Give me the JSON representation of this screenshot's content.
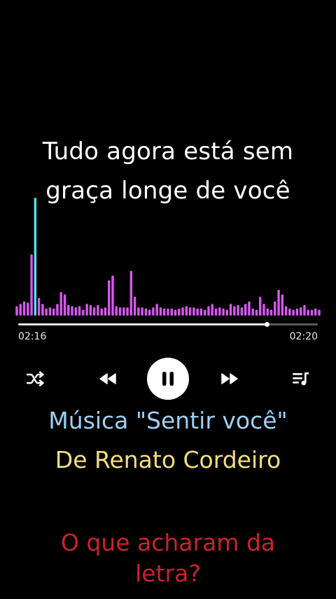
{
  "lyric": {
    "line1": "Tudo agora está sem",
    "line2": "graça longe de você"
  },
  "player": {
    "elapsed": "02:16",
    "total": "02:20",
    "progress_fraction": 0.83,
    "state": "playing",
    "controls": {
      "shuffle_icon": "shuffle-icon",
      "previous_icon": "rewind-icon",
      "pause_icon": "pause-icon",
      "next_icon": "fast-forward-icon",
      "queue_icon": "playlist-icon"
    }
  },
  "visualizer": {
    "colors": {
      "bar": "#d957f2",
      "highlight": "#4fe3ee"
    },
    "levels": [
      0.08,
      0.1,
      0.12,
      0.11,
      0.52,
      1.0,
      0.15,
      0.1,
      0.06,
      0.07,
      0.06,
      0.1,
      0.2,
      0.18,
      0.09,
      0.08,
      0.07,
      0.08,
      0.05,
      0.1,
      0.09,
      0.07,
      0.09,
      0.06,
      0.07,
      0.3,
      0.34,
      0.08,
      0.07,
      0.07,
      0.07,
      0.38,
      0.16,
      0.07,
      0.07,
      0.06,
      0.05,
      0.07,
      0.1,
      0.07,
      0.06,
      0.06,
      0.06,
      0.05,
      0.06,
      0.07,
      0.08,
      0.07,
      0.07,
      0.06,
      0.06,
      0.05,
      0.08,
      0.1,
      0.06,
      0.07,
      0.06,
      0.05,
      0.1,
      0.08,
      0.09,
      0.07,
      0.1,
      0.12,
      0.06,
      0.05,
      0.16,
      0.1,
      0.06,
      0.05,
      0.12,
      0.22,
      0.18,
      0.08,
      0.06,
      0.05,
      0.06,
      0.07,
      0.09,
      0.05,
      0.05,
      0.06,
      0.05
    ],
    "highlight_index": 5
  },
  "captions": {
    "song": "Música \"Sentir você\"",
    "artist": "De Renato Cordeiro",
    "question_line1": "O que acharam da",
    "question_line2": "letra?",
    "colors": {
      "song": "#9ecff5",
      "artist": "#f4de7c",
      "question": "#c9232b"
    }
  }
}
